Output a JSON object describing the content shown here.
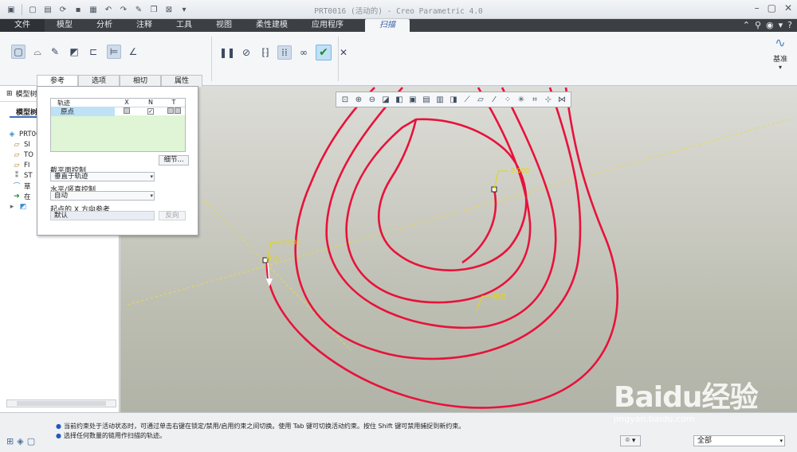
{
  "window": {
    "title": "PRT0016 (活动的) - Creo Parametric 4.0"
  },
  "ribbon_tabs": [
    {
      "label": "文件"
    },
    {
      "label": "模型"
    },
    {
      "label": "分析"
    },
    {
      "label": "注释"
    },
    {
      "label": "工具"
    },
    {
      "label": "视图"
    },
    {
      "label": "柔性建模"
    },
    {
      "label": "应用程序"
    }
  ],
  "active_tab": {
    "label": "扫描"
  },
  "ribbon": {
    "datum_label": "基准"
  },
  "left_panel": {
    "header": "模型树",
    "subtab": "模型树",
    "tree": [
      {
        "label": "PRT00",
        "icon": "part-icon"
      },
      {
        "label": "SI",
        "icon": "plane-icon"
      },
      {
        "label": "TO",
        "icon": "plane-icon"
      },
      {
        "label": "FI",
        "icon": "plane-icon"
      },
      {
        "label": "ST",
        "icon": "csys-icon"
      },
      {
        "label": "草",
        "icon": "sketch-icon"
      },
      {
        "label": "在",
        "icon": "insert-arrow-icon"
      },
      {
        "label": "",
        "icon": "sweep-feature-icon"
      }
    ]
  },
  "dashboard": {
    "tabs": [
      {
        "label": "参考"
      },
      {
        "label": "选项"
      },
      {
        "label": "相切"
      },
      {
        "label": "属性"
      }
    ],
    "trajectory_table": {
      "headers": [
        "轨迹",
        "X",
        "N",
        "T"
      ],
      "row": {
        "name": "原点"
      }
    },
    "detail_button": "细节...",
    "section_plane_control": {
      "label": "截平面控制",
      "value": "垂直于轨迹"
    },
    "hv_control": {
      "label": "水平/竖直控制",
      "value": "自动"
    },
    "x_direction": {
      "label": "起点的 X 方向参考",
      "value": "默认"
    },
    "reverse_button": "反向"
  },
  "graphics": {
    "dim_values": [
      "0.000",
      "0.000"
    ],
    "labels": [
      "原点",
      "原点"
    ]
  },
  "status": {
    "messages": [
      "当前约束处于活动状态时，可通过单击右键在锁定/禁用/启用约束之间切换。使用 Tab 键可切换活动约束。按住 Shift 键可禁用捕捉到新约束。",
      "选择任何数量的链用作扫描的轨迹。"
    ],
    "filter_value": "全部"
  },
  "watermark": {
    "main": "Baidu经验",
    "sub": "jingyan.baidu.com"
  },
  "colors": {
    "curve": "#e8123a",
    "dim": "#e6d800",
    "accent": "#3b6bb3"
  }
}
